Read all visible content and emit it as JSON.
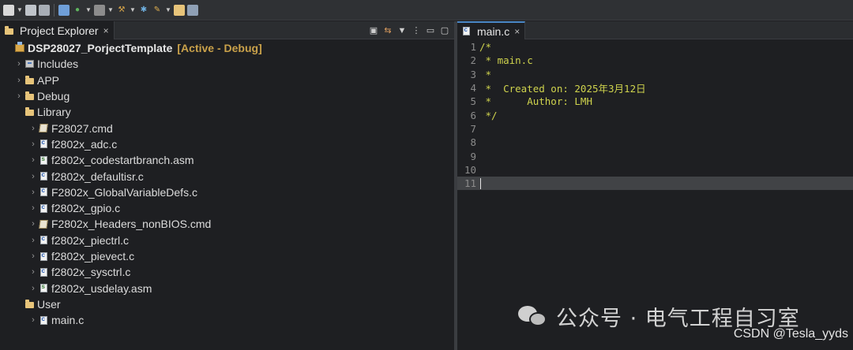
{
  "toolbar": {
    "buttons": [
      "new-icon",
      "save-icon",
      "save-all-icon",
      "console-icon",
      "debug-icon",
      "build-icon",
      "flash-icon",
      "hammer-icon",
      "tools-icon",
      "pen-icon",
      "folder-icon",
      "terminal-icon"
    ]
  },
  "project_explorer": {
    "tab_title": "Project Explorer",
    "tab_close": "×",
    "project_name": "DSP28027_PorjectTemplate",
    "project_status": "[Active - Debug]",
    "items": [
      {
        "label": "Includes",
        "icon": "includes-icon",
        "level": 1,
        "expander": "›"
      },
      {
        "label": "APP",
        "icon": "folder-icon",
        "level": 1,
        "expander": "›"
      },
      {
        "label": "Debug",
        "icon": "folder-icon",
        "level": 1,
        "expander": "›"
      },
      {
        "label": "Library",
        "icon": "folder-icon",
        "level": 1,
        "expander": ""
      },
      {
        "label": "F28027.cmd",
        "icon": "cmd-file-icon",
        "level": 2,
        "expander": "›"
      },
      {
        "label": "f2802x_adc.c",
        "icon": "c-file-icon",
        "level": 2,
        "expander": "›"
      },
      {
        "label": "f2802x_codestartbranch.asm",
        "icon": "asm-file-icon",
        "level": 2,
        "expander": "›"
      },
      {
        "label": "f2802x_defaultisr.c",
        "icon": "c-file-icon",
        "level": 2,
        "expander": "›"
      },
      {
        "label": "F2802x_GlobalVariableDefs.c",
        "icon": "c-file-icon",
        "level": 2,
        "expander": "›"
      },
      {
        "label": "f2802x_gpio.c",
        "icon": "c-file-icon",
        "level": 2,
        "expander": "›"
      },
      {
        "label": "F2802x_Headers_nonBIOS.cmd",
        "icon": "cmd-file-icon",
        "level": 2,
        "expander": "›"
      },
      {
        "label": "f2802x_piectrl.c",
        "icon": "c-file-icon",
        "level": 2,
        "expander": "›"
      },
      {
        "label": "f2802x_pievect.c",
        "icon": "c-file-icon",
        "level": 2,
        "expander": "›"
      },
      {
        "label": "f2802x_sysctrl.c",
        "icon": "c-file-icon",
        "level": 2,
        "expander": "›"
      },
      {
        "label": "f2802x_usdelay.asm",
        "icon": "asm-file-icon",
        "level": 2,
        "expander": "›"
      },
      {
        "label": "User",
        "icon": "folder-icon",
        "level": 1,
        "expander": ""
      },
      {
        "label": "main.c",
        "icon": "c-file-icon",
        "level": 2,
        "expander": "›"
      }
    ]
  },
  "editor": {
    "tab_title": "main.c",
    "tab_close": "×",
    "lines": [
      {
        "num": "1",
        "text": "/*"
      },
      {
        "num": "2",
        "text": " * main.c"
      },
      {
        "num": "3",
        "text": " *"
      },
      {
        "num": "4",
        "text": " *  Created on: 2025年3月12日"
      },
      {
        "num": "5",
        "text": " *      Author: LMH"
      },
      {
        "num": "6",
        "text": " */"
      },
      {
        "num": "7",
        "text": ""
      },
      {
        "num": "8",
        "text": ""
      },
      {
        "num": "9",
        "text": ""
      },
      {
        "num": "10",
        "text": ""
      },
      {
        "num": "11",
        "text": ""
      }
    ],
    "current_line": "11"
  },
  "watermarks": {
    "wechat": "公众号 · 电气工程自习室",
    "csdn": "CSDN @Tesla_yyds"
  },
  "colors": {
    "background": "#1e1f22",
    "comment": "#cfd34d",
    "project_status": "#c9a14a",
    "folder": "#e7c47a"
  }
}
